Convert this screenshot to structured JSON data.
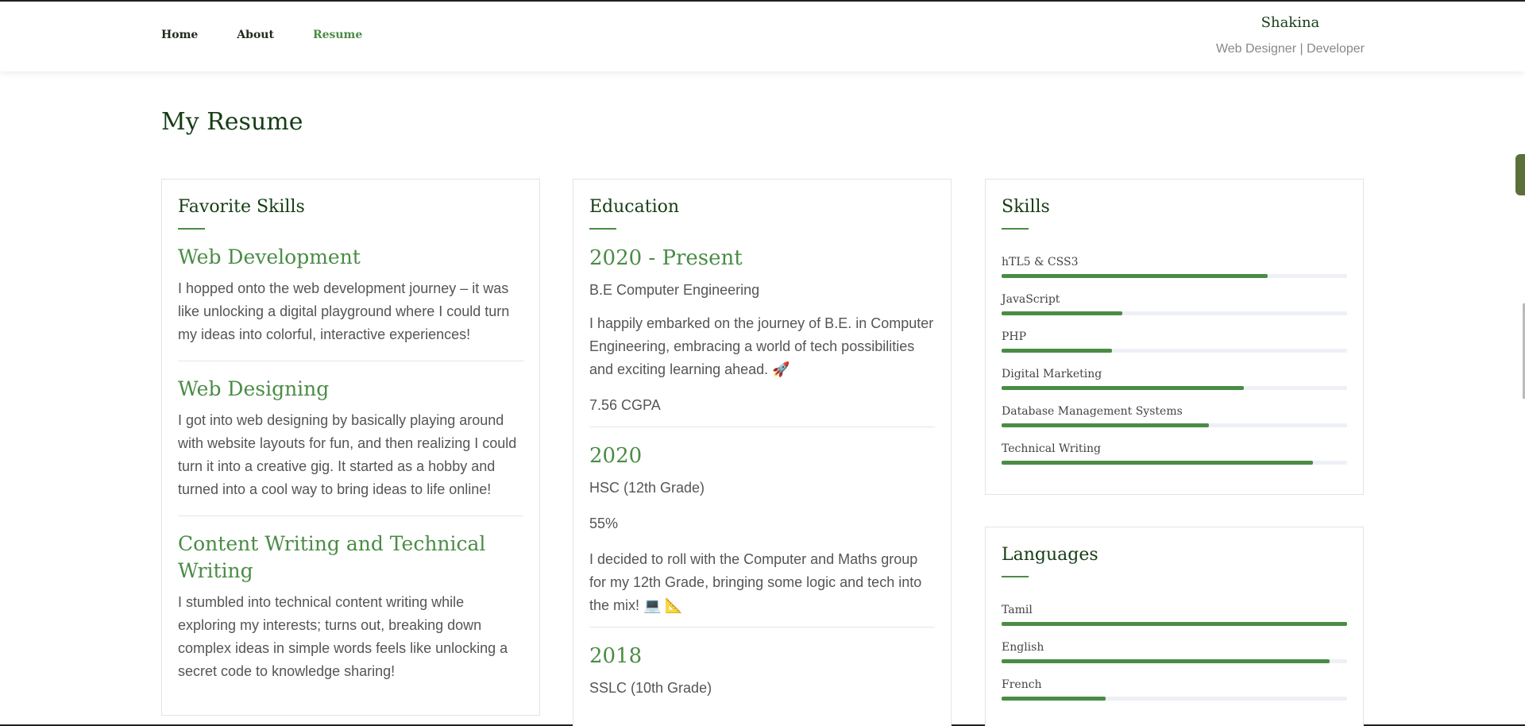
{
  "nav": {
    "items": [
      {
        "label": "Home",
        "active": false
      },
      {
        "label": "About",
        "active": false
      },
      {
        "label": "Resume",
        "active": true
      }
    ]
  },
  "brand": {
    "name": "Shakina",
    "tagline": "Web Designer | Developer"
  },
  "page_title": "My Resume",
  "favorite_skills": {
    "title": "Favorite Skills",
    "items": [
      {
        "heading": "Web Development",
        "text": "I hopped onto the web development journey – it was like unlocking a digital playground where I could turn my ideas into colorful, interactive experiences!"
      },
      {
        "heading": "Web Designing",
        "text": "I got into web designing by basically playing around with website layouts for fun, and then realizing I could turn it into a creative gig. It started as a hobby and turned into a cool way to bring ideas to life online!"
      },
      {
        "heading": "Content Writing and Technical Writing",
        "text": "I stumbled into technical content writing while exploring my interests; turns out, breaking down complex ideas in simple words feels like unlocking a secret code to knowledge sharing!"
      }
    ]
  },
  "education": {
    "title": "Education",
    "items": [
      {
        "year": "2020 - Present",
        "degree": "B.E Computer Engineering",
        "description": "I happily embarked on the journey of B.E. in Computer Engineering, embracing a world of tech possibilities and exciting learning ahead. 🚀",
        "score": "7.56 CGPA"
      },
      {
        "year": "2020",
        "degree": "HSC (12th Grade)",
        "score": "55%",
        "description": "I decided to roll with the Computer and Maths group for my 12th Grade, bringing some logic and tech into the mix! 💻 📐"
      },
      {
        "year": "2018",
        "degree": "SSLC (10th Grade)"
      }
    ]
  },
  "skills": {
    "title": "Skills",
    "items": [
      {
        "label": "hTL5 & CSS3",
        "level": 0.77
      },
      {
        "label": "JavaScript",
        "level": 0.35
      },
      {
        "label": "PHP",
        "level": 0.32
      },
      {
        "label": "Digital Marketing",
        "level": 0.7
      },
      {
        "label": "Database Management Systems",
        "level": 0.6
      },
      {
        "label": "Technical Writing",
        "level": 0.9
      }
    ]
  },
  "languages": {
    "title": "Languages",
    "items": [
      {
        "label": "Tamil",
        "level": 1.0
      },
      {
        "label": "English",
        "level": 0.95
      },
      {
        "label": "French",
        "level": 0.3
      }
    ]
  },
  "colors": {
    "accent": "#4a8c45",
    "heading": "#143d14",
    "track": "#eef0f6"
  }
}
